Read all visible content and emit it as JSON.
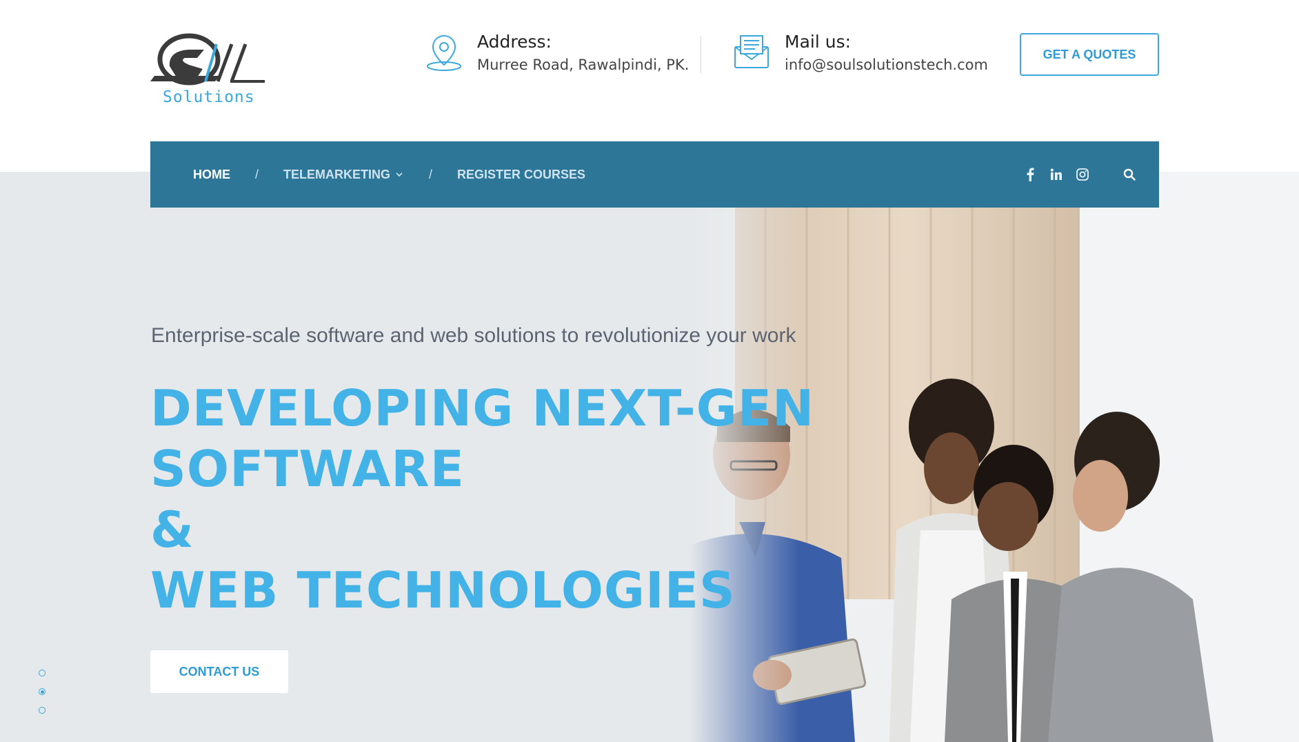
{
  "brand": {
    "logo_text": "Solutions",
    "accent_color": "#3aa8dc",
    "nav_color": "#2d7698"
  },
  "contact": {
    "address_label": "Address:",
    "address_value": "Murree Road, Rawalpindi, PK.",
    "mail_label": "Mail us:",
    "mail_value": "info@soulsolutionstech.com",
    "address_icon": "map-pin-icon",
    "mail_icon": "envelope-icon"
  },
  "header": {
    "quote_button": "GET A QUOTES"
  },
  "nav": {
    "items": [
      {
        "label": "HOME",
        "active": true
      },
      {
        "label": "TELEMARKETING",
        "dropdown": true
      },
      {
        "label": "REGISTER COURSES"
      }
    ],
    "separator": "/",
    "social": [
      "facebook-icon",
      "linkedin-icon",
      "instagram-icon"
    ],
    "search_icon": "search-icon"
  },
  "hero": {
    "tagline": "Enterprise-scale software and web solutions to revolutionize your work",
    "headline": [
      "DEVELOPING NEXT-GEN",
      "SOFTWARE",
      "&",
      "WEB TECHNOLOGIES"
    ],
    "cta": "CONTACT US",
    "slides": 3,
    "active_slide": 2
  }
}
